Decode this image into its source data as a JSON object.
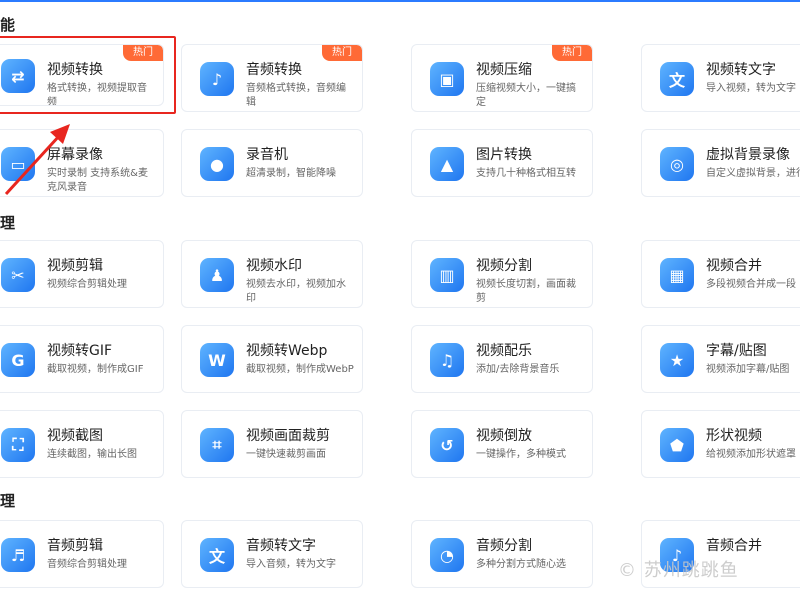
{
  "sections": [
    {
      "id": "convert",
      "title": "能"
    },
    {
      "id": "video_edit",
      "title": "理"
    },
    {
      "id": "audio_edit",
      "title": "理"
    }
  ],
  "rows": [
    [
      {
        "name": "video-convert",
        "title": "视频转换",
        "desc": "格式转换，视频提取音频",
        "badge": "热门",
        "icon": "convert-icon"
      },
      {
        "name": "audio-convert",
        "title": "音频转换",
        "desc": "音频格式转换，音频编辑",
        "badge": "热门",
        "icon": "audio-convert-icon"
      },
      {
        "name": "video-compress",
        "title": "视频压缩",
        "desc": "压缩视频大小，一键搞定",
        "badge": "热门",
        "icon": "compress-icon"
      },
      {
        "name": "video-to-text",
        "title": "视频转文字",
        "desc": "导入视频，转为文字",
        "badge": "",
        "icon": "text-icon"
      }
    ],
    [
      {
        "name": "screen-record",
        "title": "屏幕录像",
        "desc": "实时录制 支持系统&麦克风录音",
        "badge": "",
        "icon": "screen-record-icon"
      },
      {
        "name": "recorder",
        "title": "录音机",
        "desc": "超清录制，智能降噪",
        "badge": "",
        "icon": "recorder-icon"
      },
      {
        "name": "image-convert",
        "title": "图片转换",
        "desc": "支持几十种格式相互转",
        "badge": "",
        "icon": "image-icon"
      },
      {
        "name": "virtual-bg",
        "title": "虚拟背景录像",
        "desc": "自定义虚拟背景，进行",
        "badge": "",
        "icon": "virtual-bg-icon"
      }
    ],
    [
      {
        "name": "video-edit",
        "title": "视频剪辑",
        "desc": "视频综合剪辑处理",
        "badge": "",
        "icon": "edit-icon"
      },
      {
        "name": "video-watermark",
        "title": "视频水印",
        "desc": "视频去水印，视频加水印",
        "badge": "",
        "icon": "stamp-icon"
      },
      {
        "name": "video-split",
        "title": "视频分割",
        "desc": "视频长度切割，画面裁剪",
        "badge": "",
        "icon": "film-split-icon"
      },
      {
        "name": "video-merge",
        "title": "视频合并",
        "desc": "多段视频合并成一段",
        "badge": "",
        "icon": "film-merge-icon"
      }
    ],
    [
      {
        "name": "video-to-gif",
        "title": "视频转GIF",
        "desc": "截取视频，制作成GIF",
        "badge": "",
        "icon": "gif-icon"
      },
      {
        "name": "video-to-webp",
        "title": "视频转Webp",
        "desc": "截取视频，制作成WebP",
        "badge": "",
        "icon": "webp-icon"
      },
      {
        "name": "video-music",
        "title": "视频配乐",
        "desc": "添加/去除背景音乐",
        "badge": "",
        "icon": "music-icon"
      },
      {
        "name": "subtitle-sticker",
        "title": "字幕/贴图",
        "desc": "视频添加字幕/贴图",
        "badge": "",
        "icon": "star-icon"
      }
    ],
    [
      {
        "name": "video-screenshot",
        "title": "视频截图",
        "desc": "连续截图，输出长图",
        "badge": "",
        "icon": "screenshot-icon"
      },
      {
        "name": "video-crop",
        "title": "视频画面裁剪",
        "desc": "一键快速裁剪画面",
        "badge": "",
        "icon": "crop-icon"
      },
      {
        "name": "video-reverse",
        "title": "视频倒放",
        "desc": "一键操作，多种模式",
        "badge": "",
        "icon": "reverse-icon"
      },
      {
        "name": "shape-video",
        "title": "形状视频",
        "desc": "给视频添加形状遮罩",
        "badge": "",
        "icon": "shape-icon"
      }
    ],
    [
      {
        "name": "audio-edit",
        "title": "音频剪辑",
        "desc": "音频综合剪辑处理",
        "badge": "",
        "icon": "audio-edit-icon"
      },
      {
        "name": "audio-to-text",
        "title": "音频转文字",
        "desc": "导入音频，转为文字",
        "badge": "",
        "icon": "audio-text-icon"
      },
      {
        "name": "audio-split",
        "title": "音频分割",
        "desc": "多种分割方式随心选",
        "badge": "",
        "icon": "audio-split-icon"
      },
      {
        "name": "audio-merge",
        "title": "音频合并",
        "desc": "",
        "badge": "",
        "icon": "audio-merge-icon"
      }
    ]
  ],
  "watermark": "© 苏州跳跳鱼"
}
